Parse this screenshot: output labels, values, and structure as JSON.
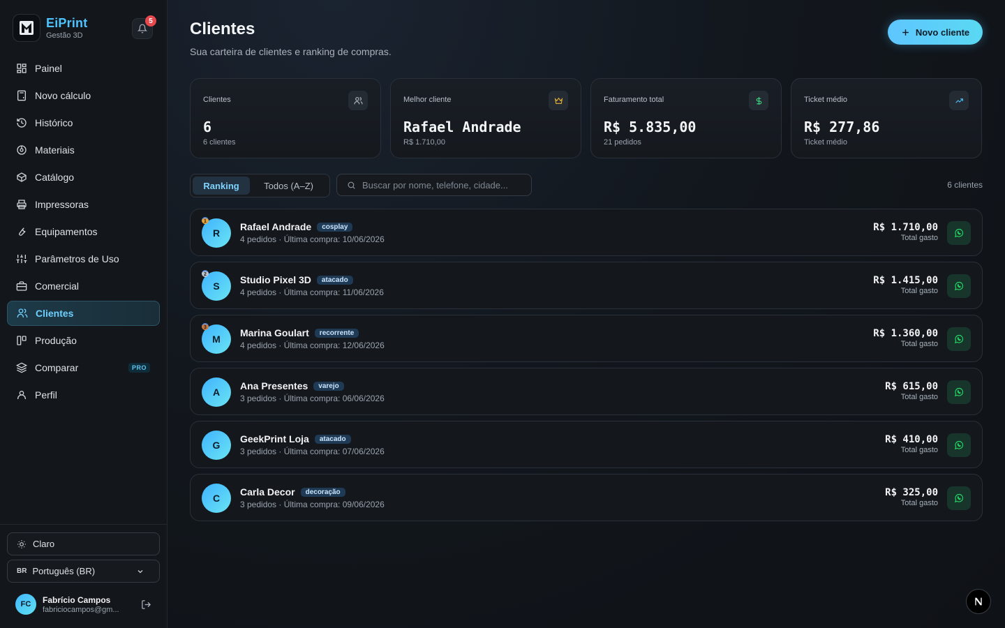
{
  "brand": {
    "name": "EiPrint",
    "subtitle": "Gestão 3D",
    "notifications": "5"
  },
  "nav": [
    {
      "label": "Painel",
      "icon": "dashboard-icon"
    },
    {
      "label": "Novo cálculo",
      "icon": "calculator-icon"
    },
    {
      "label": "Histórico",
      "icon": "history-icon"
    },
    {
      "label": "Materiais",
      "icon": "materials-icon"
    },
    {
      "label": "Catálogo",
      "icon": "box-icon"
    },
    {
      "label": "Impressoras",
      "icon": "printer-icon"
    },
    {
      "label": "Equipamentos",
      "icon": "wrench-icon"
    },
    {
      "label": "Parâmetros de Uso",
      "icon": "sliders-icon"
    },
    {
      "label": "Comercial",
      "icon": "briefcase-icon"
    },
    {
      "label": "Clientes",
      "icon": "users-icon",
      "active": true
    },
    {
      "label": "Produção",
      "icon": "production-icon"
    },
    {
      "label": "Comparar",
      "icon": "layers-icon",
      "badge": "PRO"
    },
    {
      "label": "Perfil",
      "icon": "user-icon"
    }
  ],
  "sidebar_bottom": {
    "theme_label": "Claro",
    "lang_code": "BR",
    "lang_label": "Português (BR)",
    "user": {
      "initials": "FC",
      "name": "Fabrício Campos",
      "email": "fabriciocampos@gm..."
    }
  },
  "header": {
    "title": "Clientes",
    "subtitle": "Sua carteira de clientes e ranking de compras.",
    "new_button": "Novo cliente"
  },
  "stats": [
    {
      "label": "Clientes",
      "value": "6",
      "sub": "6 clientes",
      "icon": "users-icon"
    },
    {
      "label": "Melhor cliente",
      "value": "Rafael Andrade",
      "sub": "R$ 1.710,00",
      "icon": "crown-icon"
    },
    {
      "label": "Faturamento total",
      "value": "R$ 5.835,00",
      "sub": "21 pedidos",
      "icon": "dollar-icon"
    },
    {
      "label": "Ticket médio",
      "value": "R$ 277,86",
      "sub": "Ticket médio",
      "icon": "trend-up-icon"
    }
  ],
  "toolbar": {
    "tab_ranking": "Ranking",
    "tab_all": "Todos (A–Z)",
    "search_placeholder": "Buscar por nome, telefone, cidade...",
    "count": "6 clientes"
  },
  "colors": {
    "accent": "#4dc3ff",
    "gold": "#e8a33a",
    "silver": "#c0c6cf",
    "bronze": "#c97a3f",
    "whatsapp": "#25d366"
  },
  "clients": [
    {
      "initial": "R",
      "name": "Rafael Andrade",
      "tag": "cosplay",
      "meta": "4 pedidos · Última compra: 10/06/2026",
      "total": "R$ 1.710,00",
      "total_label": "Total gasto",
      "rank": "1"
    },
    {
      "initial": "S",
      "name": "Studio Pixel 3D",
      "tag": "atacado",
      "meta": "4 pedidos · Última compra: 11/06/2026",
      "total": "R$ 1.415,00",
      "total_label": "Total gasto",
      "rank": "2"
    },
    {
      "initial": "M",
      "name": "Marina Goulart",
      "tag": "recorrente",
      "meta": "4 pedidos · Última compra: 12/06/2026",
      "total": "R$ 1.360,00",
      "total_label": "Total gasto",
      "rank": "3"
    },
    {
      "initial": "A",
      "name": "Ana Presentes",
      "tag": "varejo",
      "meta": "3 pedidos · Última compra: 06/06/2026",
      "total": "R$ 615,00",
      "total_label": "Total gasto",
      "rank": ""
    },
    {
      "initial": "G",
      "name": "GeekPrint Loja",
      "tag": "atacado",
      "meta": "3 pedidos · Última compra: 07/06/2026",
      "total": "R$ 410,00",
      "total_label": "Total gasto",
      "rank": ""
    },
    {
      "initial": "C",
      "name": "Carla Decor",
      "tag": "decoração",
      "meta": "3 pedidos · Última compra: 09/06/2026",
      "total": "R$ 325,00",
      "total_label": "Total gasto",
      "rank": ""
    }
  ]
}
